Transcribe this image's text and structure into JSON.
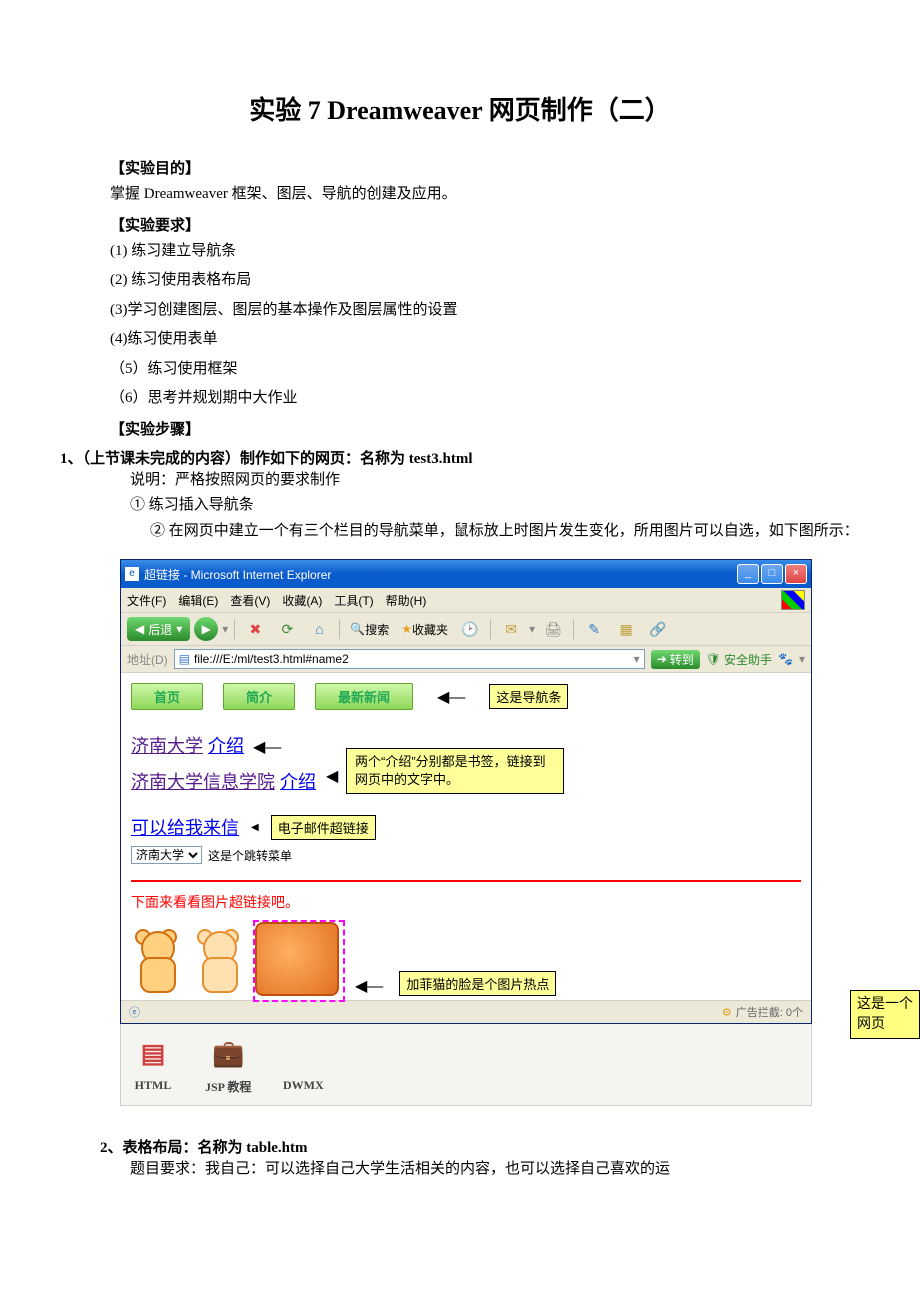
{
  "title": "实验 7  Dreamweaver 网页制作（二）",
  "h_purpose": "【实验目的】",
  "purpose_text": "掌握 Dreamweaver 框架、图层、导航的创建及应用。",
  "h_req": "【实验要求】",
  "req": [
    "(1) 练习建立导航条",
    "(2) 练习使用表格布局",
    "(3)学习创建图层、图层的基本操作及图层属性的设置",
    "(4)练习使用表单",
    "（5）练习使用框架",
    "（6）思考并规划期中大作业"
  ],
  "h_steps": "【实验步骤】",
  "step1_title": "1、（上节课未完成的内容）制作如下的网页：名称为 test3.html",
  "step1_desc": "说明：严格按照网页的要求制作",
  "step1_sub1": "①  练习插入导航条",
  "step1_sub2": "②  在网页中建立一个有三个栏目的导航菜单，鼠标放上时图片发生变化，所用图片可以自选，如下图所示：",
  "ie": {
    "title_prefix": "超链接 - Microsoft Internet Explorer",
    "menu": {
      "file": "文件(F)",
      "edit": "编辑(E)",
      "view": "查看(V)",
      "fav": "收藏(A)",
      "tool": "工具(T)",
      "help": "帮助(H)"
    },
    "back": "后退",
    "search": "搜索",
    "fav_btn": "收藏夹",
    "addr_label": "地址(D)",
    "url": "file:///E:/ml/test3.html#name2",
    "go": "转到",
    "safe": "安全助手"
  },
  "nav": {
    "home": "首页",
    "about": "简介",
    "news": "最新新闻"
  },
  "callout_nav": "这是导航条",
  "links": {
    "jinan": "济南大学",
    "intro": "介绍",
    "jinan_info": "济南大学信息学院",
    "mail": "可以给我来信"
  },
  "callout_bookmark": "两个“介绍”分别都是书签，链接到网页中的文字中。",
  "callout_email": "电子邮件超链接",
  "jump_sel": "济南大学",
  "jump_label": "这是个跳转菜单",
  "red_text": "下面来看看图片超链接吧。",
  "callout_hotspot": "加菲猫的脸是个图片热点",
  "status_ad": "广告拦截: 0个",
  "apps": {
    "html": "HTML",
    "jsp": "JSP 教程",
    "dw": "DWMX"
  },
  "side_note": "这是一个网页",
  "step2_title": "2、表格布局：名称为 table.htm",
  "step2_desc": "题目要求：我自己：可以选择自己大学生活相关的内容，也可以选择自己喜欢的运"
}
